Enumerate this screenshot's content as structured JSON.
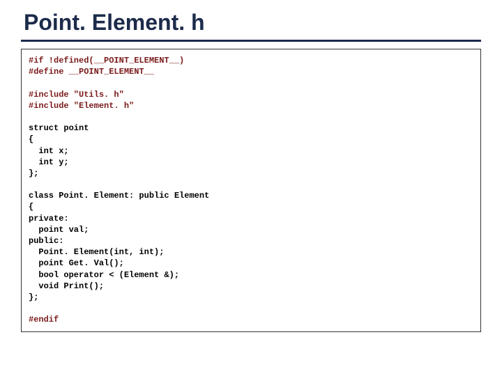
{
  "title": "Point. Element. h",
  "code": {
    "l1a": "#if !defined(__POINT_ELEMENT__)",
    "l1b": "#define __POINT_ELEMENT__",
    "l2a": "#include \"Utils. h\"",
    "l2b": "#include \"Element. h\"",
    "l3a": "struct point",
    "l3b": "{",
    "l3c": "  int x;",
    "l3d": "  int y;",
    "l3e": "};",
    "l4a": "class Point. Element: public Element",
    "l4b": "{",
    "l4c": "private:",
    "l4d": "  point val;",
    "l4e": "public:",
    "l4f": "  Point. Element(int, int);",
    "l4g": "  point Get. Val();",
    "l4h": "  bool operator < (Element &);",
    "l4i": "  void Print();",
    "l4j": "};",
    "l5": "#endif"
  }
}
